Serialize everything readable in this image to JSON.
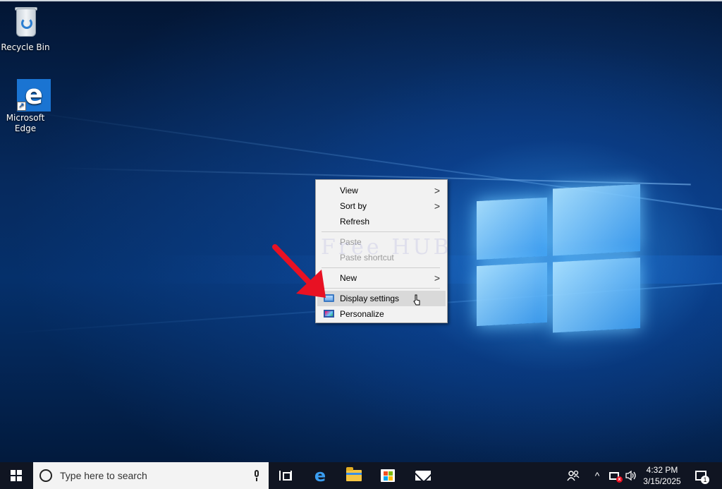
{
  "desktop": {
    "icons": [
      {
        "label": "Recycle Bin",
        "icon": "recycle-bin-icon"
      },
      {
        "label": "Microsoft Edge",
        "icon": "edge-icon"
      }
    ],
    "watermark": "Free HUB"
  },
  "context_menu": {
    "items": [
      {
        "label": "View",
        "has_submenu": true,
        "disabled": false
      },
      {
        "label": "Sort by",
        "has_submenu": true,
        "disabled": false
      },
      {
        "label": "Refresh",
        "has_submenu": false,
        "disabled": false
      },
      {
        "label": "Paste",
        "has_submenu": false,
        "disabled": true
      },
      {
        "label": "Paste shortcut",
        "has_submenu": false,
        "disabled": true
      },
      {
        "label": "New",
        "has_submenu": true,
        "disabled": false
      },
      {
        "label": "Display settings",
        "icon": "display-icon",
        "highlighted": true
      },
      {
        "label": "Personalize",
        "icon": "personalize-icon"
      }
    ],
    "submenu_arrow": ">"
  },
  "taskbar": {
    "search_placeholder": "Type here to search",
    "edge_letter": "e",
    "clock_time": "4:32 PM",
    "clock_date": "3/15/2025",
    "notification_count": "1",
    "chevron": "^"
  },
  "colors": {
    "taskbar": "#101522",
    "menu_bg": "#f2f2f2",
    "menu_hover": "#d9d9d9",
    "annotation_arrow": "#e81123"
  }
}
